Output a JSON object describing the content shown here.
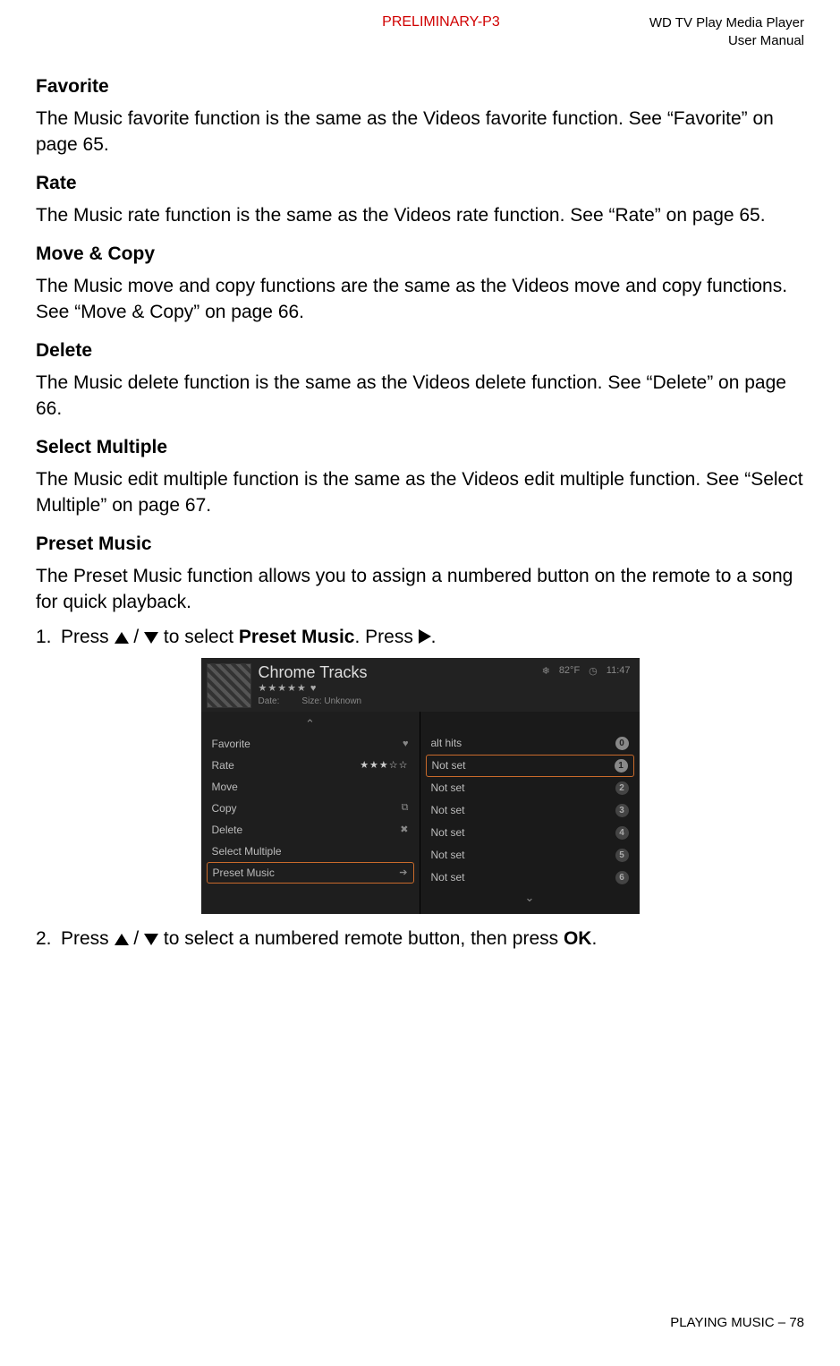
{
  "header": {
    "preliminary": "PRELIMINARY-P3",
    "product_line1": "WD TV Play Media Player",
    "product_line2": "User Manual"
  },
  "sections": {
    "favorite": {
      "title": "Favorite",
      "body": "The Music favorite function is the same as the Videos favorite function. See “Favorite” on page 65."
    },
    "rate": {
      "title": "Rate",
      "body": "The Music rate function is the same as the Videos rate function. See “Rate” on page 65."
    },
    "movecopy": {
      "title": "Move & Copy",
      "body": "The Music move and copy functions are the same as the Videos move and copy functions. See “Move & Copy” on page 66."
    },
    "delete": {
      "title": "Delete",
      "body": "The Music delete function is the same as the Videos delete function. See “Delete” on page 66."
    },
    "selectmultiple": {
      "title": "Select Multiple",
      "body": "The Music edit multiple function is the same as the Videos edit multiple function. See “Select Multiple” on page 67."
    },
    "presetmusic": {
      "title": "Preset Music",
      "body": "The Preset Music function allows you to assign a numbered button on the remote to a song for quick playback."
    }
  },
  "steps": {
    "s1_num": "1.",
    "s1_a": "Press ",
    "s1_b": " to select ",
    "s1_preset": "Preset Music",
    "s1_c": ". Press ",
    "s1_d": ".",
    "slash": " / ",
    "s2_num": "2.",
    "s2_a": "Press ",
    "s2_b": " to select a numbered remote button, then press ",
    "s2_ok": "OK",
    "s2_c": "."
  },
  "shot": {
    "title": "Chrome Tracks",
    "stars": "★★★★★ ♥",
    "meta_date": "Date:",
    "meta_size": "Size: Unknown",
    "temp": "82°F",
    "time": "11:47",
    "left": {
      "favorite": "Favorite",
      "rate": "Rate",
      "move": "Move",
      "copy": "Copy",
      "delete": "Delete",
      "selectmultiple": "Select Multiple",
      "presetmusic": "Preset Music",
      "rate_stars": "★★★☆☆",
      "heart": "♥",
      "copy_ic": "⧉",
      "del_ic": "✖",
      "arrow_ic": "➔"
    },
    "right": {
      "althits": "alt hits",
      "notset": "Not set",
      "n0": "0",
      "n1": "1",
      "n2": "2",
      "n3": "3",
      "n4": "4",
      "n5": "5",
      "n6": "6"
    },
    "chev_up": "⌃",
    "chev_down": "⌄"
  },
  "footer": {
    "section": "PLAYING MUSIC",
    "sep": " – ",
    "page": "78"
  }
}
